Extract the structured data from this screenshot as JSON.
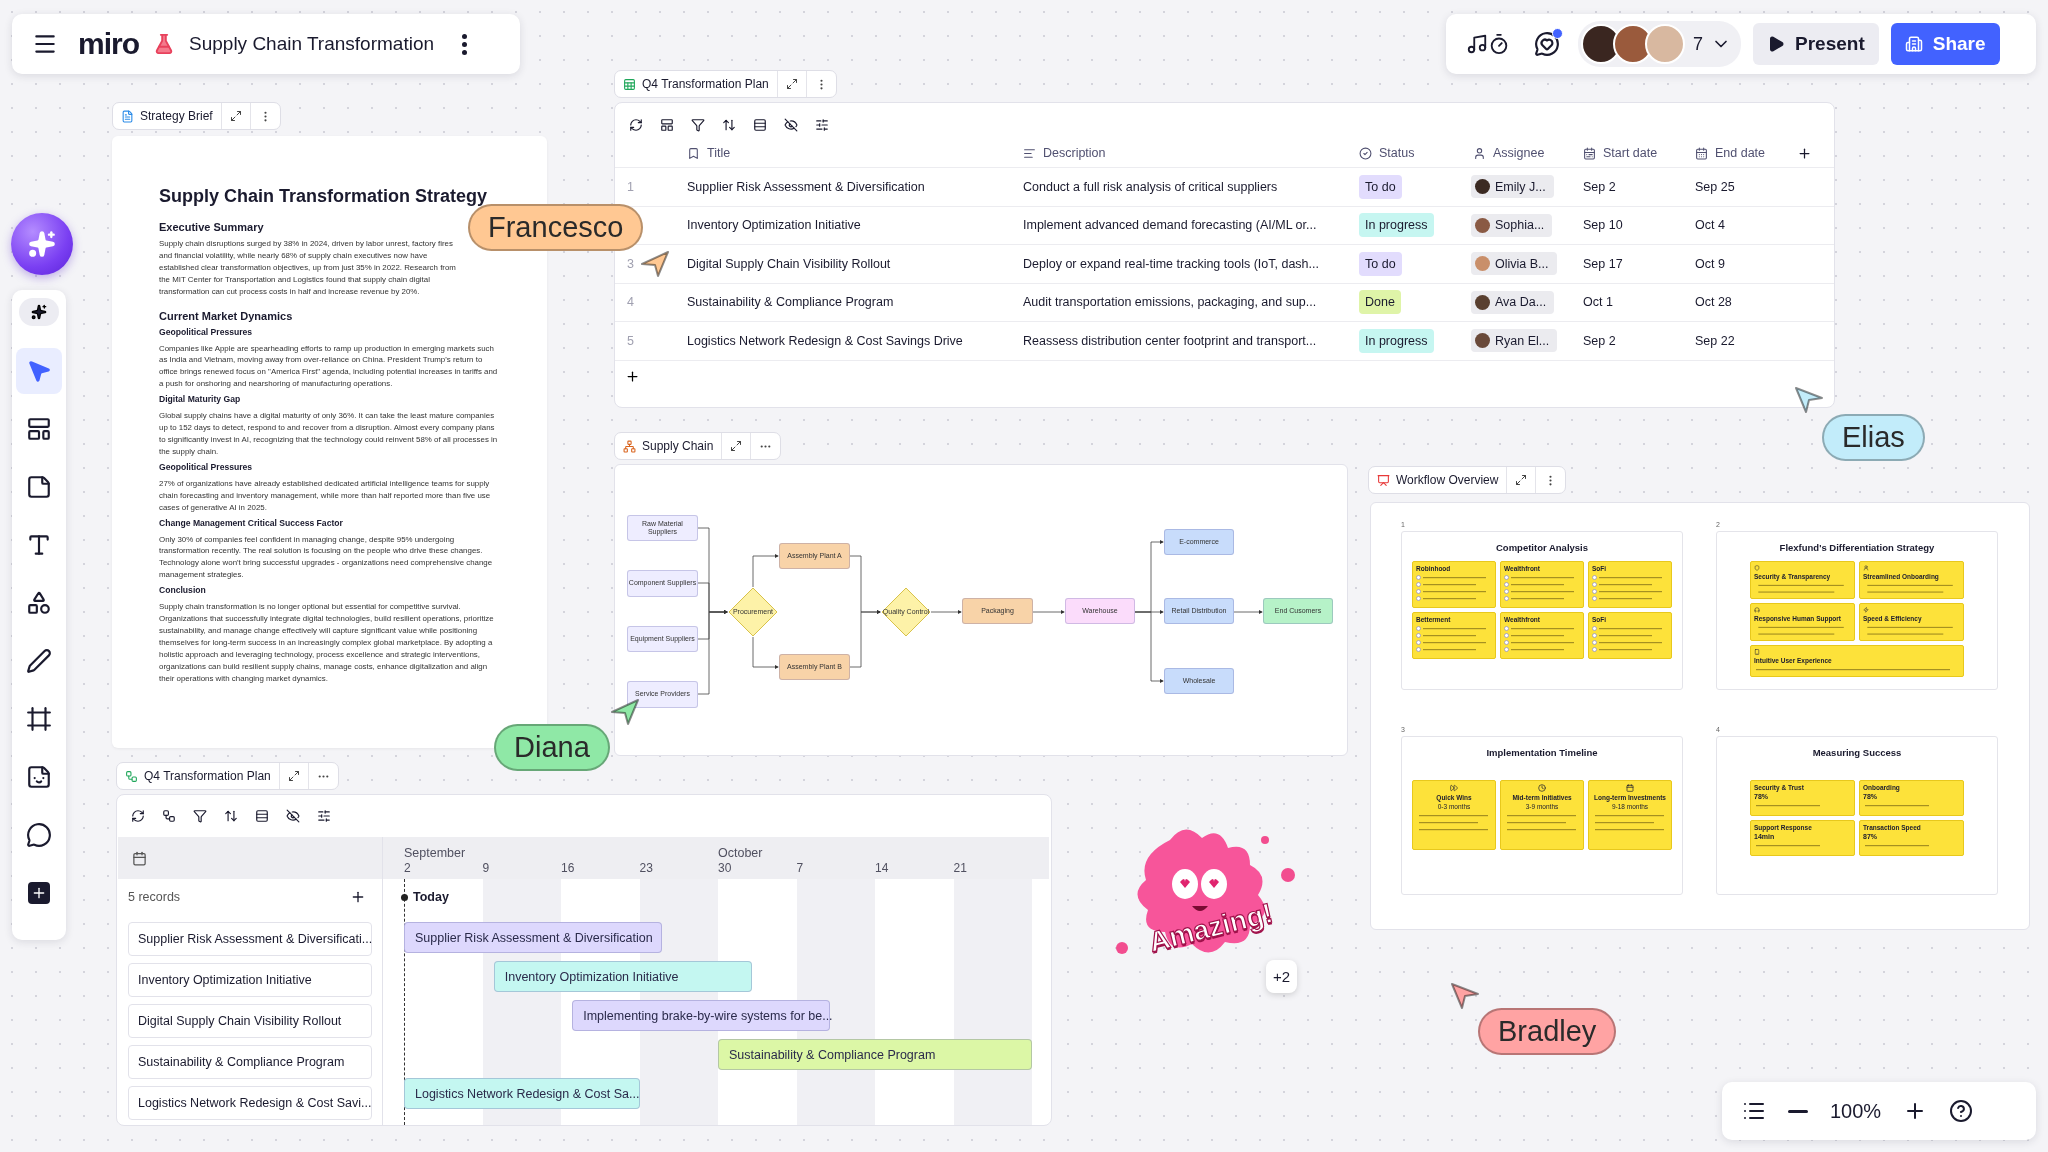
{
  "topbar": {
    "logo": "miro",
    "board_title": "Supply Chain Transformation"
  },
  "collab": {
    "unread": true,
    "count": "7",
    "present": "Present",
    "share": "Share"
  },
  "toolbar": {
    "tools": [
      {
        "kind": "select",
        "selected": true
      },
      {
        "kind": "templates",
        "selected": false
      },
      {
        "kind": "sticky",
        "selected": false
      },
      {
        "kind": "text",
        "selected": false
      },
      {
        "kind": "shapes",
        "selected": false
      },
      {
        "kind": "pen",
        "selected": false
      },
      {
        "kind": "frame",
        "selected": false
      },
      {
        "kind": "sticker",
        "selected": false
      },
      {
        "kind": "comment",
        "selected": false
      },
      {
        "kind": "more",
        "selected": false
      }
    ]
  },
  "brief": {
    "label": "Strategy Brief",
    "title": "Supply Chain Transformation Strategy",
    "blocks": [
      {
        "kind": "h2",
        "text": "Executive Summary"
      },
      {
        "kind": "p",
        "text": "Supply chain disruptions surged by 38% in 2024, driven by labor unrest, factory fires and financial volatility, while nearly 68% of supply chain executives now have established clear transformation objectives, up from just 35% in 2022. Research from the MIT Center for Transportation and Logistics found that supply chain digital transformation can cut process costs in half and increase revenue by 20%."
      },
      {
        "kind": "h2",
        "text": "Current Market Dynamics"
      },
      {
        "kind": "h3",
        "text": "Geopolitical Pressures"
      },
      {
        "kind": "p",
        "text": "Companies like Apple are spearheading efforts to ramp up production in emerging markets such as India and Vietnam, moving away from over-reliance on China. President Trump's return to office brings renewed focus on \"America First\" agenda, including potential increases in tariffs and a push for onshoring and nearshoring of manufacturing operations."
      },
      {
        "kind": "h3",
        "text": "Digital Maturity Gap"
      },
      {
        "kind": "p",
        "text": "Global supply chains have a digital maturity of only 36%. It can take the least mature companies up to 152 days to detect, respond to and recover from a disruption. Almost every company plans to significantly invest in AI, recognizing that the technology could reinvent 58% of all processes in the supply chain."
      },
      {
        "kind": "h3",
        "text": "Geopolitical Pressures"
      },
      {
        "kind": "p",
        "text": "27% of organizations have already established dedicated artificial intelligence teams for supply chain forecasting and inventory management, while more than half reported more than five use cases of generative AI in 2025."
      },
      {
        "kind": "h3",
        "text": "Change Management Critical Success Factor"
      },
      {
        "kind": "p",
        "text": "Only 30% of companies feel confident in managing change, despite 95% undergoing transformation recently. The real solution is focusing on the people who drive these changes. Technology alone won't bring successful upgrades - organizations need comprehensive change management strategies."
      },
      {
        "kind": "h3",
        "text": "Conclusion"
      },
      {
        "kind": "p",
        "text": "Supply chain transformation is no longer optional but essential for competitive survival. Organizations that successfully integrate digital technologies, build resilient operations, prioritize sustainability, and manage change effectively will capture significant value while positioning themselves for long-term success in an increasingly complex global marketplace. By adopting a holistic approach and leveraging technology, process excellence and strategic interventions, organizations can build resilient supply chains, manage costs, enhance digitalization and align their operations with changing market dynamics."
      }
    ]
  },
  "table": {
    "label": "Q4 Transformation Plan",
    "columns": [
      {
        "kind": "title",
        "label": "Title"
      },
      {
        "kind": "description",
        "label": "Description"
      },
      {
        "kind": "status",
        "label": "Status"
      },
      {
        "kind": "assignee",
        "label": "Assignee"
      },
      {
        "kind": "start",
        "label": "Start date"
      },
      {
        "kind": "end",
        "label": "End date"
      }
    ],
    "rows": [
      {
        "number": "1",
        "title": "Supplier Risk Assessment & Diversification",
        "description": "Conduct a full risk analysis of critical suppliers",
        "status": {
          "label": "To do",
          "kind": "todo"
        },
        "assignee": "Emily J...",
        "start": "Sep 2",
        "end": "Sep 25"
      },
      {
        "title": "Inventory Optimization Initiative",
        "description": "Implement advanced demand forecasting (AI/ML or...",
        "status": {
          "label": "In progress",
          "kind": "in_progress"
        },
        "assignee": "Sophia...",
        "start": "Sep 10",
        "end": "Oct 4"
      },
      {
        "number": "3",
        "title": "Digital Supply Chain Visibility Rollout",
        "description": "Deploy or expand real-time tracking tools (IoT, dash...",
        "status": {
          "label": "To do",
          "kind": "todo"
        },
        "assignee": "Olivia B...",
        "start": "Sep 17",
        "end": "Oct 9"
      },
      {
        "number": "4",
        "title": "Sustainability & Compliance Program",
        "description": "Audit transportation emissions, packaging, and sup...",
        "status": {
          "label": "Done",
          "kind": "done"
        },
        "assignee": "Ava Da...",
        "start": "Oct 1",
        "end": "Oct 28"
      },
      {
        "number": "5",
        "title": "Logistics Network Redesign & Cost Savings Drive",
        "description": "Reassess distribution center footprint and transport...",
        "status": {
          "label": "In progress",
          "kind": "in_progress"
        },
        "assignee": "Ryan El...",
        "start": "Sep 2",
        "end": "Sep 22"
      }
    ]
  },
  "diagram": {
    "label": "Supply Chain",
    "nodes": [
      {
        "label": "Raw Material Suppliers",
        "kind": "process",
        "color": "#eeedff"
      },
      {
        "label": "Component Suppliers",
        "kind": "process",
        "color": "#eeedff"
      },
      {
        "label": "Equipment Suppliers",
        "kind": "process",
        "color": "#eeedff"
      },
      {
        "label": "Service Providers",
        "kind": "process",
        "color": "#eeedff"
      },
      {
        "label": "Procurement",
        "kind": "decision",
        "color": "#fdf2a8"
      },
      {
        "label": "Assembly Plant A",
        "kind": "process",
        "color": "#f8d3a8"
      },
      {
        "label": "Assembly Plant B",
        "kind": "process",
        "color": "#f8d3a8"
      },
      {
        "label": "Quality Control",
        "kind": "decision",
        "color": "#fdf2a8"
      },
      {
        "label": "Packaging",
        "kind": "process",
        "color": "#f8d3a8"
      },
      {
        "label": "Warehouse",
        "kind": "process",
        "color": "#fbdcfb"
      },
      {
        "label": "E-commerce",
        "kind": "process",
        "color": "#c8dcfb"
      },
      {
        "label": "Retail Distribution",
        "kind": "process",
        "color": "#c8dcfb"
      },
      {
        "label": "Wholesale",
        "kind": "process",
        "color": "#c8dcfb"
      },
      {
        "label": "End Cusomers",
        "kind": "process",
        "color": "#b6f2c8"
      }
    ]
  },
  "workflow": {
    "label": "Workflow Overview",
    "slides": [
      {
        "number": "1",
        "title": "Competitor Analysis",
        "kind": "comparison",
        "cards": [
          {
            "title": "Robinhood"
          },
          {
            "title": "Wealthfront"
          },
          {
            "title": "SoFi"
          },
          {
            "title": "Betterment"
          },
          {
            "title": "Wealthfront"
          },
          {
            "title": "SoFi"
          }
        ]
      },
      {
        "number": "2",
        "title": "Flexfund's Differentiation Strategy",
        "kind": "features",
        "cards": [
          {
            "title": "Security & Transparency"
          },
          {
            "title": "Streamlined Onboarding"
          },
          {
            "title": "Responsive Human Support"
          },
          {
            "title": "Speed & Efficiency"
          },
          {
            "title": "Intuitive User Experience"
          }
        ]
      },
      {
        "number": "3",
        "title": "Implementation Timeline",
        "kind": "timeline",
        "cards": [
          {
            "title": "Quick Wins",
            "subtitle": "0-3 months"
          },
          {
            "title": "Mid-term Initiatives",
            "subtitle": "3-9 months"
          },
          {
            "title": "Long-term Investments",
            "subtitle": "9-18 months"
          }
        ]
      },
      {
        "number": "4",
        "title": "Measuring Success",
        "kind": "metrics",
        "cards": [
          {
            "title": "Security & Trust",
            "value": "78%"
          },
          {
            "title": "Onboarding",
            "value": "78%"
          },
          {
            "title": "Support Response",
            "value": "14min"
          },
          {
            "title": "Transaction Speed",
            "value": "87%"
          }
        ]
      }
    ]
  },
  "gantt": {
    "label": "Q4 Transformation Plan",
    "months": [
      "September",
      "October"
    ],
    "weeks": [
      "2",
      "9",
      "16",
      "23",
      "30",
      "7",
      "14",
      "21"
    ],
    "today": "Today",
    "records": "5 records",
    "rows": [
      "Supplier Risk Assessment & Diversificati...",
      "Inventory Optimization Initiative",
      "Digital Supply Chain Visibility Rollout",
      "Sustainability & Compliance Program",
      "Logistics Network Redesign & Cost Savi..."
    ],
    "bars": [
      {
        "label": "Supplier Risk Assessment & Diversification",
        "color": "#ddd8fd"
      },
      {
        "label": "Inventory Optimization Initiative",
        "color": "#c4f7f1"
      },
      {
        "label": "Implementing brake-by-wire systems for be...",
        "color": "#ddd8fd"
      },
      {
        "label": "Sustainability & Compliance Program",
        "color": "#dcf7a6"
      },
      {
        "label": "Logistics Network Redesign & Cost Sa...",
        "color": "#c4f7f1"
      }
    ]
  },
  "cursors": [
    {
      "name": "Francesco",
      "color": "#ffc893"
    },
    {
      "name": "Elias",
      "color": "#c2ecfa"
    },
    {
      "name": "Diana",
      "color": "#8fe8a6"
    },
    {
      "name": "Bradley",
      "color": "#ffa3a3"
    }
  ],
  "sticker": {
    "text": "Amazing!",
    "extra": "+2"
  },
  "zoom_bar": {
    "zoom": "100%"
  }
}
